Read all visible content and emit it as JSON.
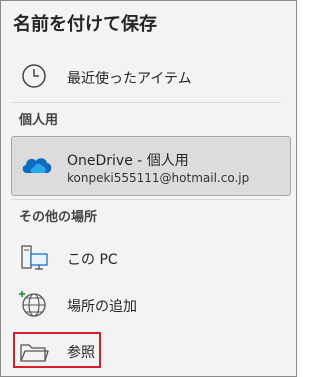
{
  "title": "名前を付けて保存",
  "recent": {
    "label": "最近使ったアイテム",
    "icon": "clock-icon"
  },
  "personal_section": {
    "header": "個人用"
  },
  "onedrive": {
    "title": "OneDrive - 個人用",
    "email": "konpeki555111@hotmail.co.jp",
    "icon": "onedrive-cloud-icon",
    "accent": "#0f6cbd"
  },
  "other_section": {
    "header": "その他の場所"
  },
  "this_pc": {
    "label": "この PC",
    "icon": "computer-icon"
  },
  "add_place": {
    "label": "場所の追加",
    "icon": "globe-plus-icon"
  },
  "browse": {
    "label": "参照",
    "icon": "folder-icon",
    "highlight_color": "#d81e2a"
  }
}
